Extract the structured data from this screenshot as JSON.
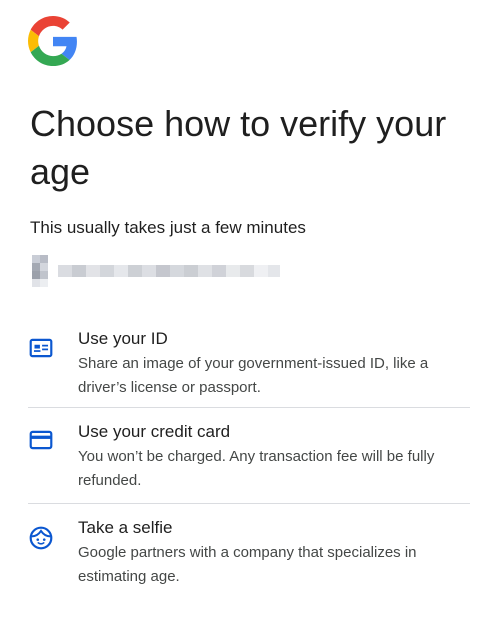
{
  "brand": {
    "logo_icon": "google-g-logo",
    "colors": {
      "blue": "#4285F4",
      "red": "#EA4335",
      "yellow": "#FBBC05",
      "green": "#34A853",
      "accent": "#0b57d0"
    }
  },
  "header": {
    "title": "Choose how to verify your age",
    "subtitle": "This usually takes just a few minutes"
  },
  "account": {
    "note": "blurred account identifier",
    "icon": "avatar-icon"
  },
  "options": [
    {
      "icon": "id-card-icon",
      "title": "Use your ID",
      "description": "Share an image of your government-issued ID, like a driver’s license or passport."
    },
    {
      "icon": "credit-card-icon",
      "title": "Use your credit card",
      "description": "You won’t be charged. Any transaction fee will be fully refunded."
    },
    {
      "icon": "selfie-face-icon",
      "title": "Take a selfie",
      "description": "Google partners with a company that specializes in estimating age."
    }
  ]
}
